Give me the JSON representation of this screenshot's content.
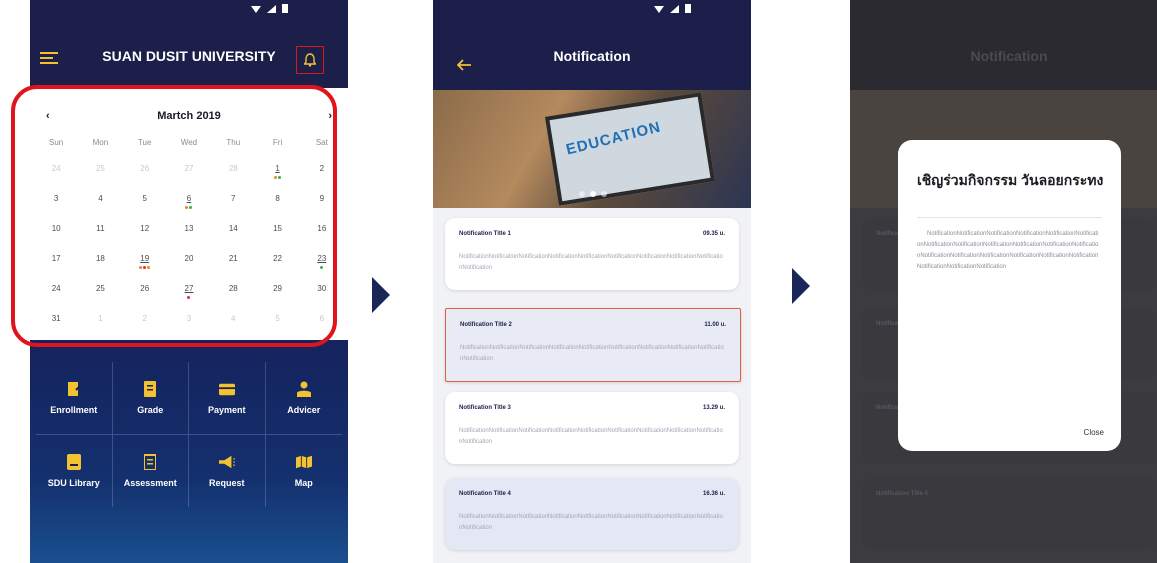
{
  "screen1": {
    "app_title": "SUAN DUSIT UNIVERSITY",
    "calendar": {
      "month_label": "Martch 2019",
      "prev": "‹",
      "next": "›",
      "weekdays": [
        "Sun",
        "Mon",
        "Tue",
        "Wed",
        "Thu",
        "Fri",
        "Sat"
      ],
      "rows": [
        [
          {
            "d": "24",
            "dim": true
          },
          {
            "d": "25",
            "dim": true
          },
          {
            "d": "26",
            "dim": true
          },
          {
            "d": "27",
            "dim": true
          },
          {
            "d": "28",
            "dim": true
          },
          {
            "d": "1",
            "ev": [
              "#e88a1f",
              "#37b24d"
            ]
          },
          {
            "d": "2"
          }
        ],
        [
          {
            "d": "3"
          },
          {
            "d": "4"
          },
          {
            "d": "5"
          },
          {
            "d": "6",
            "ev": [
              "#e88a1f",
              "#37b24d"
            ]
          },
          {
            "d": "7"
          },
          {
            "d": "8"
          },
          {
            "d": "9"
          }
        ],
        [
          {
            "d": "10"
          },
          {
            "d": "11"
          },
          {
            "d": "12"
          },
          {
            "d": "13"
          },
          {
            "d": "14"
          },
          {
            "d": "15"
          },
          {
            "d": "16"
          }
        ],
        [
          {
            "d": "17"
          },
          {
            "d": "18"
          },
          {
            "d": "19",
            "ev": [
              "#e88a1f",
              "#e03131",
              "#e88a1f"
            ]
          },
          {
            "d": "20"
          },
          {
            "d": "21"
          },
          {
            "d": "22"
          },
          {
            "d": "23",
            "ev": [
              "#37b24d"
            ]
          }
        ],
        [
          {
            "d": "24"
          },
          {
            "d": "25"
          },
          {
            "d": "26"
          },
          {
            "d": "27",
            "ev": [
              "#e03131"
            ]
          },
          {
            "d": "28"
          },
          {
            "d": "29"
          },
          {
            "d": "30"
          }
        ],
        [
          {
            "d": "31"
          },
          {
            "d": "1",
            "dim": true
          },
          {
            "d": "2",
            "dim": true
          },
          {
            "d": "3",
            "dim": true
          },
          {
            "d": "4",
            "dim": true
          },
          {
            "d": "5",
            "dim": true
          },
          {
            "d": "6",
            "dim": true
          }
        ]
      ]
    },
    "menu": [
      {
        "label": "Enrollment",
        "icon": "enrollment-icon"
      },
      {
        "label": "Grade",
        "icon": "grade-icon"
      },
      {
        "label": "Payment",
        "icon": "payment-icon"
      },
      {
        "label": "Advicer",
        "icon": "advicer-icon"
      },
      {
        "label": "SDU Library",
        "icon": "library-icon"
      },
      {
        "label": "Assessment",
        "icon": "assessment-icon"
      },
      {
        "label": "Request",
        "icon": "request-icon"
      },
      {
        "label": "Map",
        "icon": "map-icon"
      }
    ]
  },
  "screen2": {
    "title": "Notification",
    "banner_text": "EDUCATION",
    "notifications": [
      {
        "title": "Notification Title 1",
        "time": "09.35 u.",
        "body": "NotificationNotificationNotificationNotificationNotificationNotificationNotificationNotificationNotificationNotification"
      },
      {
        "title": "Notification Title 2",
        "time": "11.00 u.",
        "body": "NotificationNotificationNotificationNotificationNotificationNotificationNotificationNotificationNotificationNotification"
      },
      {
        "title": "Notification Title 3",
        "time": "13.29 u.",
        "body": "NotificationNotificationNotificationNotificationNotificationNotificationNotificationNotificationNotificationNotification"
      },
      {
        "title": "Notification Title 4",
        "time": "16.36 u.",
        "body": "NotificationNotificationNotificationNotificationNotificationNotificationNotificationNotificationNotificationNotification"
      }
    ]
  },
  "screen3": {
    "dim_title": "Notification",
    "dialog": {
      "title": "เชิญร่วมกิจกรรม วันลอยกระทง",
      "body": "NotificationNotificationNotificationNotificationNotificationNotificationNotificationNotificationNotificationNotificationNotificationNotificationNotificationNotificationNotificationNotificationNotificationNotificationNotificationNotificationNotification",
      "close_label": "Close"
    },
    "dim_cards": [
      {
        "title": "Notification Title 1"
      },
      {
        "title": "Notification Title 2"
      },
      {
        "title": "Notification Title 3"
      },
      {
        "title": "Notification Title 4"
      }
    ]
  },
  "colors": {
    "navy": "#1b1f4a",
    "highlight_red": "#e0141c",
    "selected_border": "#e3603d",
    "arrow": "#1b2658"
  }
}
